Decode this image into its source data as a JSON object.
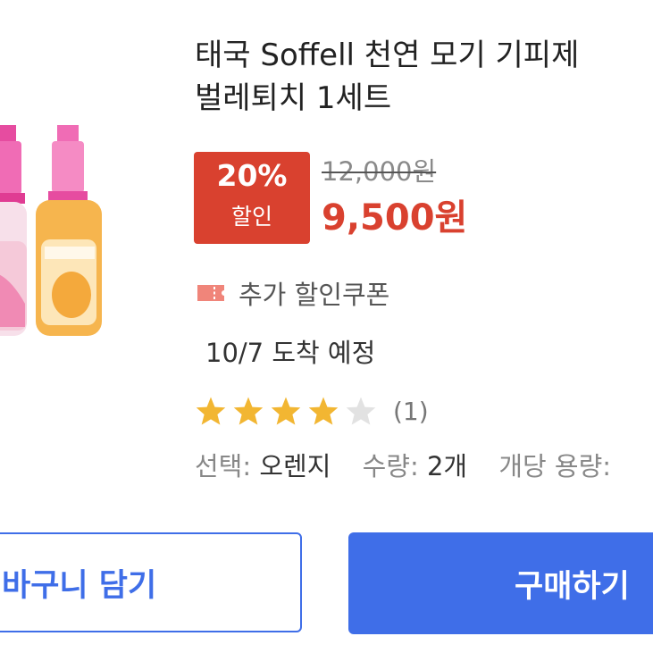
{
  "product": {
    "title_line1": "태국 Soffell 천연 모기 기피제",
    "title_line2": "벌레퇴치 1세트",
    "discount_rate": "20%",
    "discount_word": "할인",
    "original_price": "12,000원",
    "sale_price": "9,500원",
    "coupon_text": "추가 할인쿠폰",
    "delivery_text": "10/7 도착 예정",
    "rating": {
      "stars_filled": 4,
      "stars_total": 5,
      "review_count": "(1)"
    },
    "options": {
      "select_label": "선택:",
      "select_value": "오렌지",
      "qty_label": "수량:",
      "qty_value": "2개",
      "volume_label": "개당 용량:"
    }
  },
  "buttons": {
    "cart": "바구니 담기",
    "buy": "구매하기"
  },
  "icons": {
    "coupon": "coupon-icon",
    "star": "star-icon"
  },
  "colors": {
    "accent_red": "#d9412f",
    "accent_blue": "#3f6ee8",
    "star_gold": "#f2b632",
    "star_empty": "#e2e2e2"
  }
}
